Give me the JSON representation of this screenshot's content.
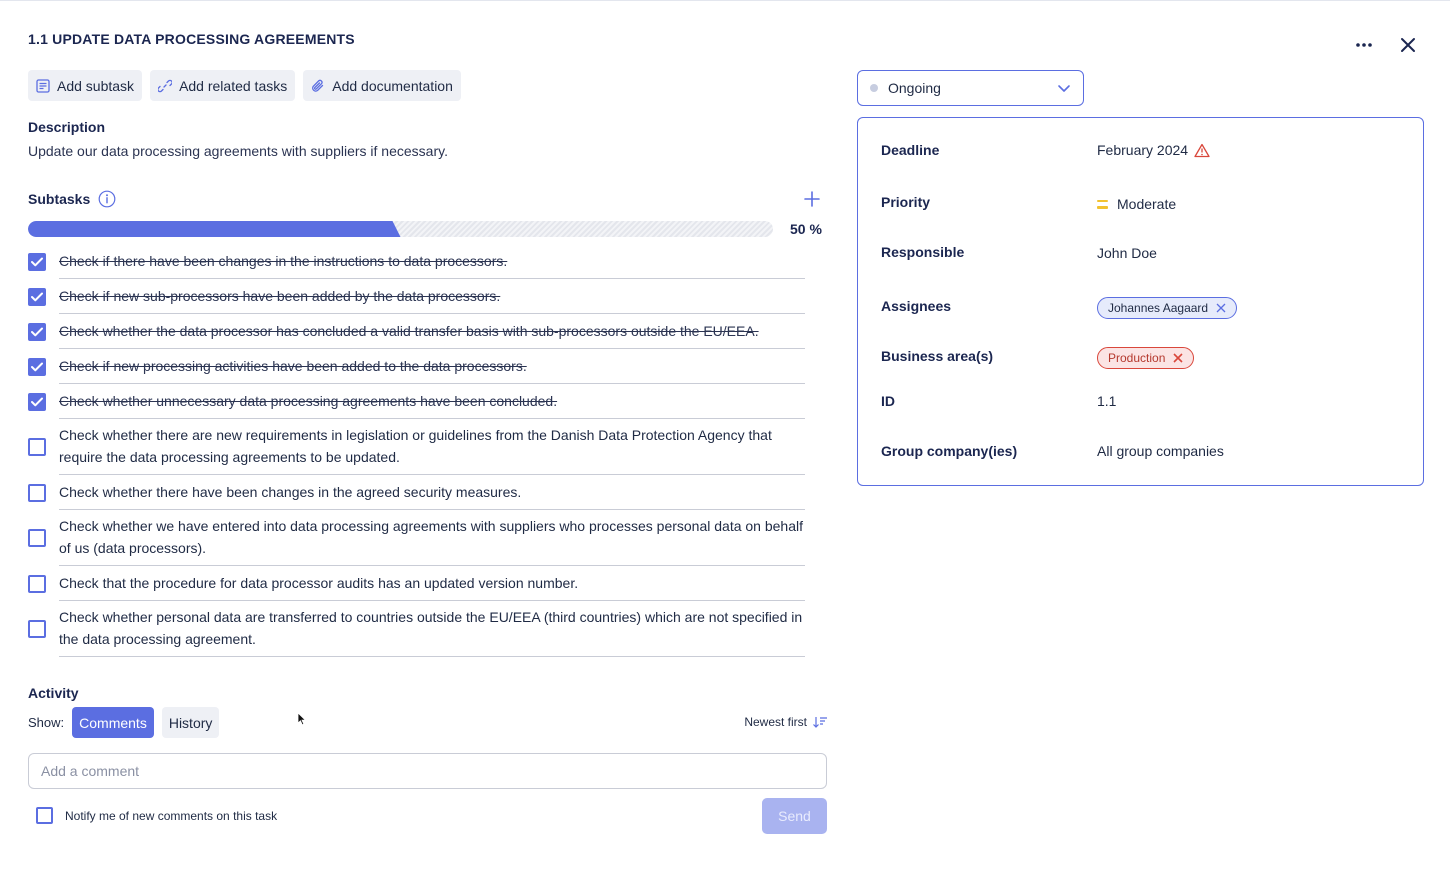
{
  "header": {
    "title": "1.1 UPDATE DATA PROCESSING AGREEMENTS",
    "more_icon": "more-horizontal-icon",
    "close_icon": "close-icon"
  },
  "toolbar": {
    "add_subtask": "Add subtask",
    "add_related": "Add related tasks",
    "add_documentation": "Add documentation"
  },
  "description": {
    "heading": "Description",
    "text": "Update our data processing agreements with suppliers if necessary."
  },
  "subtasks": {
    "heading": "Subtasks",
    "progress_fraction": 0.5,
    "progress_label": "50 %",
    "items": [
      {
        "label": "Check if there have been changes in the instructions to data processors.",
        "done": true
      },
      {
        "label": "Check if new sub-processors have been added by the data processors.",
        "done": true
      },
      {
        "label": "Check whether the data processor has concluded a valid transfer basis with sub-processors outside the EU/EEA.",
        "done": true
      },
      {
        "label": "Check if new processing activities have been added to the data processors.",
        "done": true
      },
      {
        "label": "Check whether unnecessary data processing agreements have been concluded.",
        "done": true
      },
      {
        "label": "Check whether there are new requirements in legislation or guidelines from the Danish Data Protection Agency that require the data processing agreements to be updated.",
        "done": false
      },
      {
        "label": "Check whether there have been changes in the agreed security measures.",
        "done": false
      },
      {
        "label": "Check whether we have entered into data processing agreements with suppliers who processes personal data on behalf of us (data processors).",
        "done": false
      },
      {
        "label": "Check that the procedure for data processor audits has an updated version number.",
        "done": false
      },
      {
        "label": "Check whether personal data are transferred to countries outside the EU/EEA (third countries) which are not specified in the data processing agreement.",
        "done": false
      }
    ]
  },
  "activity": {
    "heading": "Activity",
    "show_label": "Show:",
    "tabs": [
      "Comments",
      "History"
    ],
    "active_tab": "Comments",
    "sort_label": "Newest first",
    "comment_placeholder": "Add a comment",
    "notify_label": "Notify me of new comments on this task",
    "send_label": "Send"
  },
  "status": {
    "value": "Ongoing"
  },
  "details": {
    "deadline_label": "Deadline",
    "deadline_value": "February 2024",
    "priority_label": "Priority",
    "priority_value": "Moderate",
    "responsible_label": "Responsible",
    "responsible_value": "John Doe",
    "assignees_label": "Assignees",
    "assignees": [
      "Johannes Aagaard"
    ],
    "business_label": "Business area(s)",
    "business_areas": [
      "Production"
    ],
    "id_label": "ID",
    "id_value": "1.1",
    "group_label": "Group company(ies)",
    "group_value": "All group companies"
  },
  "colors": {
    "accent": "#5b6ee1",
    "warning": "#d9473b",
    "priority_moderate": "#f2c230"
  }
}
